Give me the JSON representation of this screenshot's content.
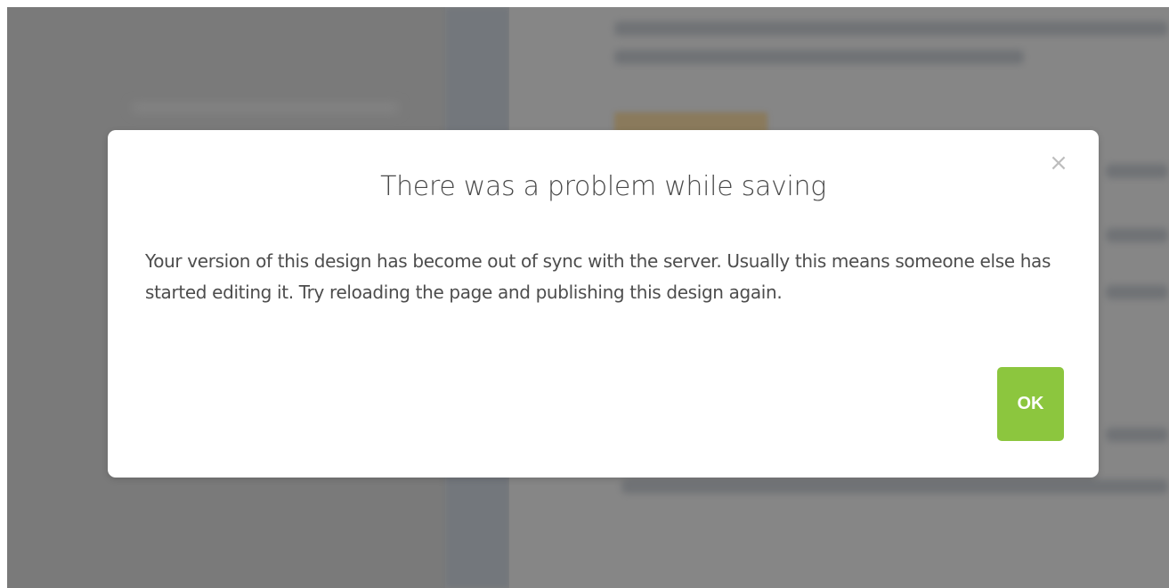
{
  "dialog": {
    "title": "There was a problem while saving",
    "message": "Your version of this design has become out of sync with the server. Usually this means someone else has started editing it. Try reloading the page and publishing this design again.",
    "close_glyph": "×",
    "ok_label": "OK"
  },
  "icons": {
    "close": "close-icon"
  },
  "colors": {
    "ok_button": "#8cc63e",
    "overlay": "#7f7f7f",
    "title_text": "#4a4a4a",
    "body_text": "#4d4d4d",
    "close_icon": "#bdbdbd"
  }
}
